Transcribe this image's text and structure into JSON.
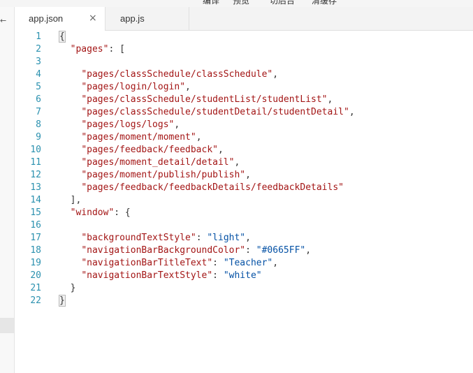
{
  "toolbar": {
    "items": [
      "编译",
      "预览",
      "切后台",
      "清缓存"
    ]
  },
  "sidebar": {
    "arrow": "←"
  },
  "tabs": [
    {
      "label": "app.json",
      "active": true,
      "close": "×"
    },
    {
      "label": "app.js",
      "active": false
    }
  ],
  "editor": {
    "lines": [
      {
        "n": "1",
        "tokens": [
          {
            "t": "{",
            "c": "bracket"
          }
        ]
      },
      {
        "n": "2",
        "tokens": [
          {
            "t": "  "
          },
          {
            "t": "\"pages\"",
            "c": "k"
          },
          {
            "t": ": ["
          }
        ]
      },
      {
        "n": "3",
        "tokens": []
      },
      {
        "n": "4",
        "tokens": [
          {
            "t": "    "
          },
          {
            "t": "\"pages/classSchedule/classSchedule\"",
            "c": "s"
          },
          {
            "t": ","
          }
        ]
      },
      {
        "n": "5",
        "tokens": [
          {
            "t": "    "
          },
          {
            "t": "\"pages/login/login\"",
            "c": "s"
          },
          {
            "t": ","
          }
        ]
      },
      {
        "n": "6",
        "tokens": [
          {
            "t": "    "
          },
          {
            "t": "\"pages/classSchedule/studentList/studentList\"",
            "c": "s"
          },
          {
            "t": ","
          }
        ]
      },
      {
        "n": "7",
        "tokens": [
          {
            "t": "    "
          },
          {
            "t": "\"pages/classSchedule/studentDetail/studentDetail\"",
            "c": "s"
          },
          {
            "t": ","
          }
        ]
      },
      {
        "n": "8",
        "tokens": [
          {
            "t": "    "
          },
          {
            "t": "\"pages/logs/logs\"",
            "c": "s"
          },
          {
            "t": ","
          }
        ]
      },
      {
        "n": "9",
        "tokens": [
          {
            "t": "    "
          },
          {
            "t": "\"pages/moment/moment\"",
            "c": "s"
          },
          {
            "t": ","
          }
        ]
      },
      {
        "n": "10",
        "tokens": [
          {
            "t": "    "
          },
          {
            "t": "\"pages/feedback/feedback\"",
            "c": "s"
          },
          {
            "t": ","
          }
        ]
      },
      {
        "n": "11",
        "tokens": [
          {
            "t": "    "
          },
          {
            "t": "\"pages/moment_detail/detail\"",
            "c": "s"
          },
          {
            "t": ","
          }
        ]
      },
      {
        "n": "12",
        "tokens": [
          {
            "t": "    "
          },
          {
            "t": "\"pages/moment/publish/publish\"",
            "c": "s"
          },
          {
            "t": ","
          }
        ]
      },
      {
        "n": "13",
        "tokens": [
          {
            "t": "    "
          },
          {
            "t": "\"pages/feedback/feedbackDetails/feedbackDetails\"",
            "c": "s"
          }
        ]
      },
      {
        "n": "14",
        "tokens": [
          {
            "t": "  ],"
          }
        ]
      },
      {
        "n": "15",
        "tokens": [
          {
            "t": "  "
          },
          {
            "t": "\"window\"",
            "c": "k"
          },
          {
            "t": ": {"
          }
        ]
      },
      {
        "n": "16",
        "tokens": []
      },
      {
        "n": "17",
        "tokens": [
          {
            "t": "    "
          },
          {
            "t": "\"backgroundTextStyle\"",
            "c": "k"
          },
          {
            "t": ": "
          },
          {
            "t": "\"light\"",
            "c": "v"
          },
          {
            "t": ","
          }
        ]
      },
      {
        "n": "18",
        "tokens": [
          {
            "t": "    "
          },
          {
            "t": "\"navigationBarBackgroundColor\"",
            "c": "k"
          },
          {
            "t": ": "
          },
          {
            "t": "\"#0665FF\"",
            "c": "v"
          },
          {
            "t": ","
          }
        ]
      },
      {
        "n": "19",
        "tokens": [
          {
            "t": "    "
          },
          {
            "t": "\"navigationBarTitleText\"",
            "c": "k"
          },
          {
            "t": ": "
          },
          {
            "t": "\"Teacher\"",
            "c": "v"
          },
          {
            "t": ","
          }
        ]
      },
      {
        "n": "20",
        "tokens": [
          {
            "t": "    "
          },
          {
            "t": "\"navigationBarTextStyle\"",
            "c": "k"
          },
          {
            "t": ": "
          },
          {
            "t": "\"white\"",
            "c": "v"
          }
        ]
      },
      {
        "n": "21",
        "tokens": [
          {
            "t": "  }"
          }
        ]
      },
      {
        "n": "22",
        "tokens": [
          {
            "t": "}",
            "c": "bracket"
          }
        ]
      }
    ]
  }
}
